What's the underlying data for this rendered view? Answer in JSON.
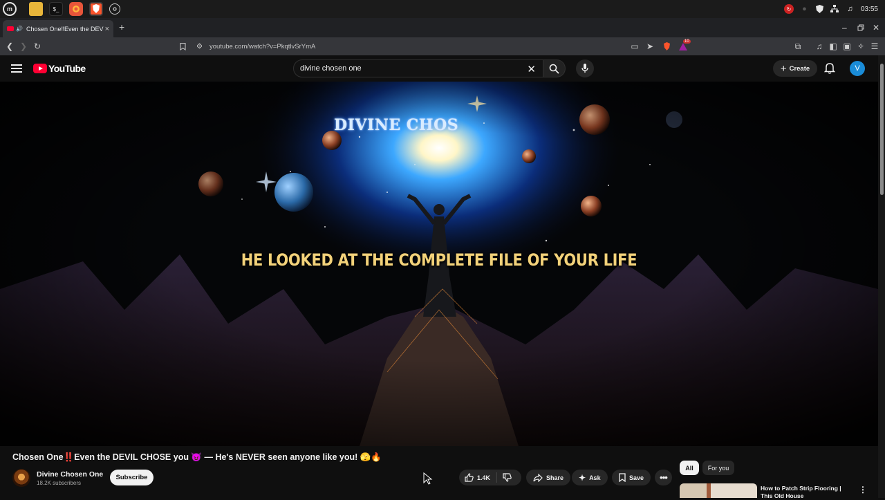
{
  "taskbar": {
    "apps": [
      "mint-menu-icon",
      "files-icon",
      "terminal-icon",
      "firefox-icon",
      "brave-icon",
      "chrome-icon"
    ],
    "time": "03:55"
  },
  "browser": {
    "tab_title": "Chosen One‼Even the DEVIL",
    "new_tab": "+",
    "url": "youtube.com/watch?v=PkqtlvSrYmA",
    "extension_badge": "10"
  },
  "youtube": {
    "logo_text": "YouTube",
    "search_value": "divine chosen one",
    "create_label": "Create",
    "avatar_letter": "V"
  },
  "video": {
    "overlay_title": "DIVINE CHOS",
    "caption": "HE LOOKED AT THE COMPLETE FILE OF YOUR LIFE",
    "title": "Chosen One‼️Even the DEVIL CHOSE you 😈 — He's NEVER seen anyone like you! 🫣🔥",
    "channel_name": "Divine Chosen One",
    "subscribers": "18.2K subscribers",
    "subscribe_label": "Subscribe",
    "like_count": "1.4K",
    "share_label": "Share",
    "ask_label": "Ask",
    "save_label": "Save"
  },
  "sidebar": {
    "chips": [
      {
        "label": "All",
        "active": true
      },
      {
        "label": "For you",
        "active": false
      }
    ],
    "recommendation_title": "How to Patch Strip Flooring | This Old House"
  },
  "colors": {
    "background": "#0f0f0f",
    "youtube_red": "#ff0033",
    "caption_gold": "#f3d27a"
  }
}
